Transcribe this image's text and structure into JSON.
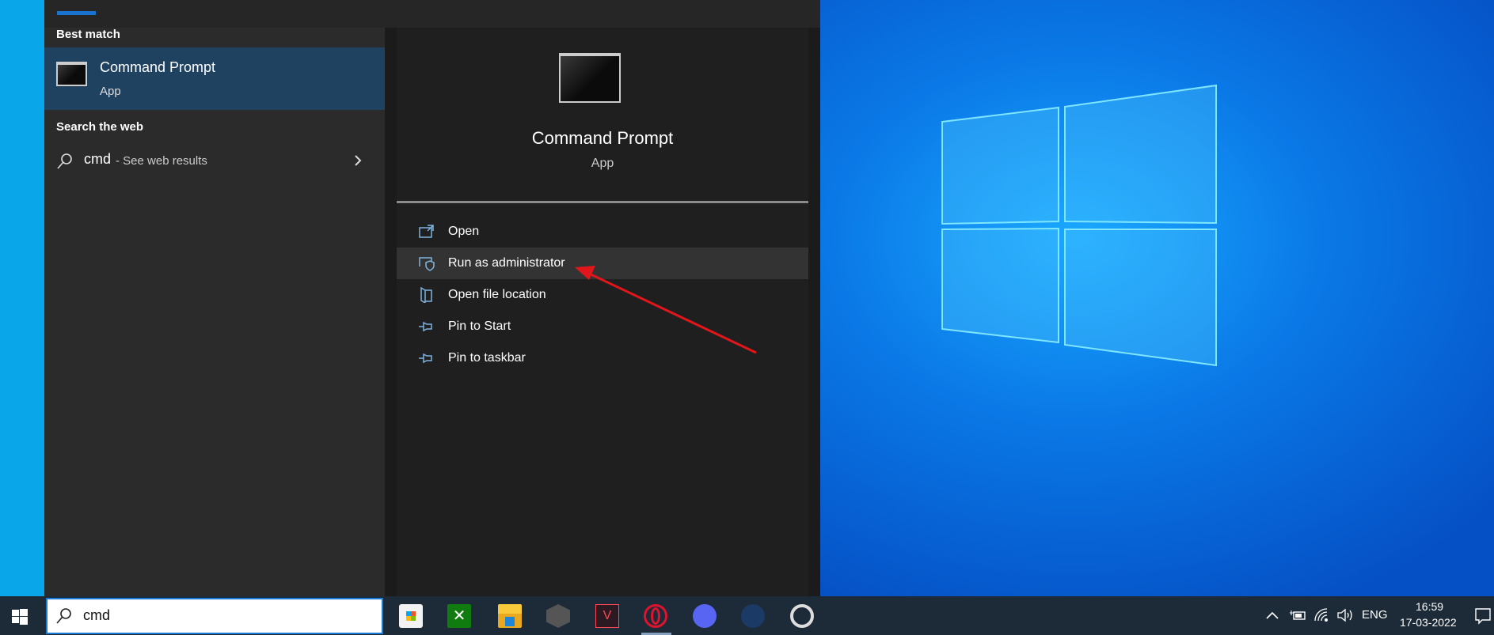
{
  "start_menu": {
    "best_match_heading": "Best match",
    "best_match": {
      "title": "Command Prompt",
      "subtitle": "App"
    },
    "search_web_heading": "Search the web",
    "web_result": {
      "query": "cmd",
      "suffix": " - See web results"
    },
    "preview": {
      "title": "Command Prompt",
      "subtitle": "App",
      "actions": [
        {
          "label": "Open",
          "icon": "open-window-icon"
        },
        {
          "label": "Run as administrator",
          "icon": "shield-window-icon"
        },
        {
          "label": "Open file location",
          "icon": "file-location-icon"
        },
        {
          "label": "Pin to Start",
          "icon": "pin-icon"
        },
        {
          "label": "Pin to taskbar",
          "icon": "pin-icon"
        }
      ]
    }
  },
  "taskbar": {
    "search_value": "cmd",
    "apps": [
      "Microsoft Store",
      "Xbox",
      "File Explorer",
      "Epic/Launcher",
      "Valorant",
      "Opera GX",
      "Discord",
      "Steam",
      "Ubisoft Connect"
    ],
    "tray": {
      "language": "ENG",
      "time": "16:59",
      "date": "17-03-2022"
    }
  },
  "colors": {
    "accent": "#1a73d1",
    "selection": "#1f4260",
    "annotation_arrow": "#e0161b"
  }
}
